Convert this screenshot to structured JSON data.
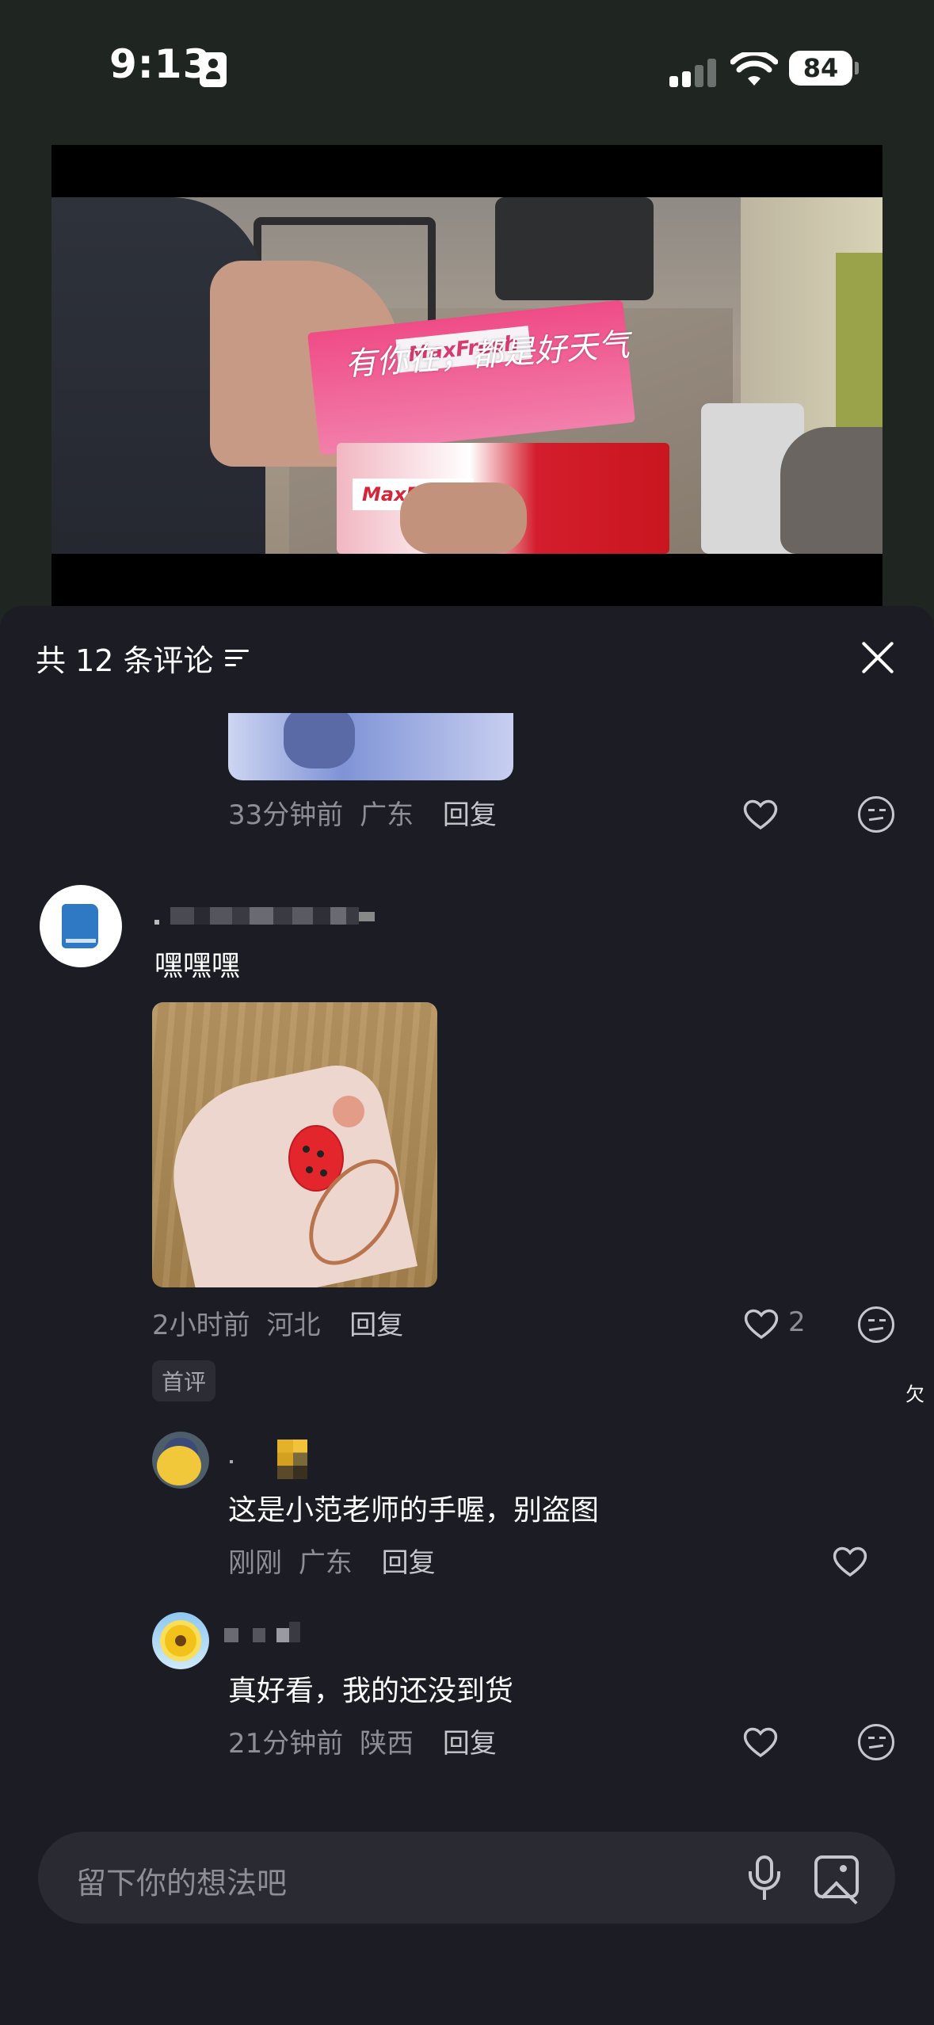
{
  "status_bar": {
    "time": "9:13",
    "battery": "84"
  },
  "video": {
    "overlay_text": "有你在，都是好天气",
    "box_brand": "MaxFresh",
    "box_brand_2": "MaxFresh"
  },
  "comments": {
    "header": "共 12 条评论",
    "previous_comment": {
      "time": "33分钟前",
      "location": "广东",
      "reply_label": "回复"
    },
    "main_comment": {
      "text": "嘿嘿嘿",
      "time": "2小时前",
      "location": "河北",
      "reply_label": "回复",
      "likes": "2",
      "tag": "首评"
    },
    "replies": [
      {
        "text": "这是小范老师的手喔，别盗图",
        "time": "刚刚",
        "location": "广东",
        "reply_label": "回复"
      },
      {
        "text": "真好看，我的还没到货",
        "time": "21分钟前",
        "location": "陕西",
        "reply_label": "回复"
      }
    ]
  },
  "input": {
    "placeholder": "留下你的想法吧"
  },
  "corner_char": "欠",
  "colors": {
    "sheet_bg": "#1c1c24",
    "page_bg": "#1f2622",
    "muted_text": "#8e8e95"
  },
  "icons": [
    "id-card-icon",
    "signal-icon",
    "wifi-icon",
    "battery-icon",
    "filter-icon",
    "close-icon",
    "heart-icon",
    "dislike-icon",
    "microphone-icon",
    "image-icon"
  ]
}
